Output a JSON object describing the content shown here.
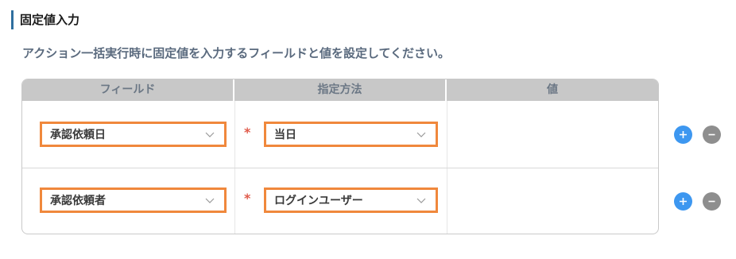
{
  "section": {
    "title": "固定値入力",
    "description": "アクション一括実行時に固定値を入力するフィールドと値を設定してください。"
  },
  "table": {
    "headers": [
      "フィールド",
      "指定方法",
      "値"
    ],
    "rows": [
      {
        "field": "承認依頼日",
        "required_mark": "*",
        "method": "当日",
        "value": ""
      },
      {
        "field": "承認依頼者",
        "required_mark": "*",
        "method": "ログインユーザー",
        "value": ""
      }
    ]
  },
  "icons": {
    "add": "plus-icon",
    "remove": "minus-icon",
    "dropdown": "chevron-down-icon"
  },
  "colors": {
    "accent_border": "#f0883c",
    "add_button": "#3d97f0",
    "remove_button": "#8e8e8e",
    "required": "#e05a4a",
    "title_bar": "#2f6f9f"
  }
}
